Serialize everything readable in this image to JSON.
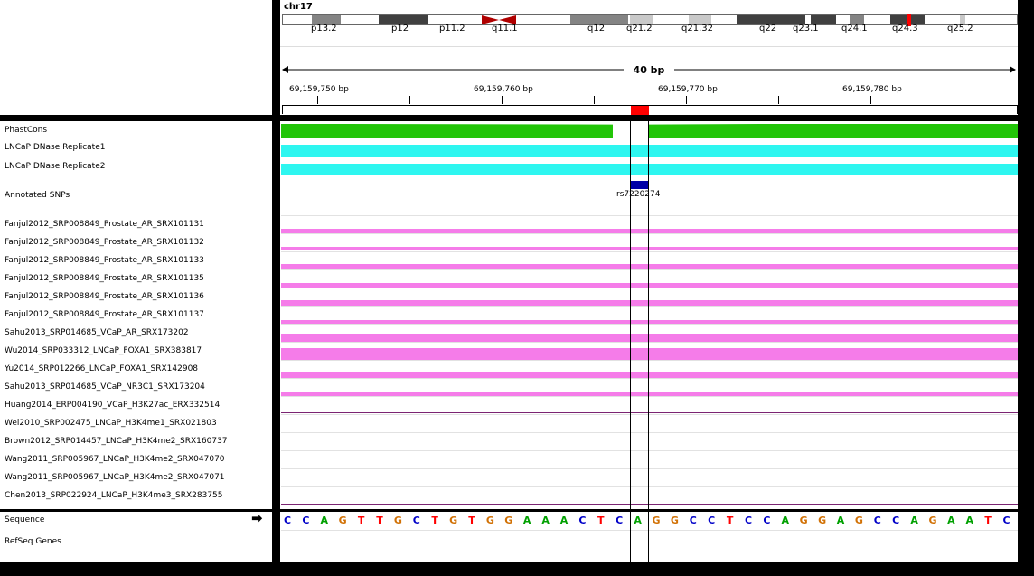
{
  "ideogram": {
    "chromosome": "chr17",
    "bands": [
      {
        "label": "p13.2",
        "color": "#848484"
      },
      {
        "label": "p12",
        "color": "#404040"
      },
      {
        "label": "p11.2",
        "color": "#ffffff"
      },
      {
        "label": "q11.1",
        "color": "#b00000"
      },
      {
        "label": "q12",
        "color": "#848484"
      },
      {
        "label": "q21.2",
        "color": "#c9c9c9"
      },
      {
        "label": "q21.32",
        "color": "#c9c9c9"
      },
      {
        "label": "q22",
        "color": "#404040"
      },
      {
        "label": "q23.1",
        "color": "#404040"
      },
      {
        "label": "q24.1",
        "color": "#848484"
      },
      {
        "label": "q24.3",
        "color": "#404040"
      },
      {
        "label": "q25.2",
        "color": "#c9c9c9"
      }
    ],
    "current_position_color": "#ff0000"
  },
  "ruler": {
    "span_label": "40 bp",
    "ticks": [
      "69,159,750 bp",
      "69,159,760 bp",
      "69,159,770 bp",
      "69,159,780 bp"
    ]
  },
  "tracks": {
    "phastcons": {
      "name": "PhastCons",
      "color": "#22c508"
    },
    "dnase1": {
      "name": "LNCaP DNase Replicate1",
      "color": "#2ef6f0"
    },
    "dnase2": {
      "name": "LNCaP DNase Replicate2",
      "color": "#2ef6f0"
    },
    "snps": {
      "name": "Annotated SNPs",
      "feature_label": "rs7220274",
      "color": "#0000a6"
    },
    "chip": [
      "Fanjul2012_SRP008849_Prostate_AR_SRX101131",
      "Fanjul2012_SRP008849_Prostate_AR_SRX101132",
      "Fanjul2012_SRP008849_Prostate_AR_SRX101133",
      "Fanjul2012_SRP008849_Prostate_AR_SRX101135",
      "Fanjul2012_SRP008849_Prostate_AR_SRX101136",
      "Fanjul2012_SRP008849_Prostate_AR_SRX101137",
      "Sahu2013_SRP014685_VCaP_AR_SRX173202",
      "Wu2014_SRP033312_LNCaP_FOXA1_SRX383817",
      "Yu2014_SRP012266_LNCaP_FOXA1_SRX142908",
      "Sahu2013_SRP014685_VCaP_NR3C1_SRX173204",
      "Huang2014_ERP004190_VCaP_H3K27ac_ERX332514",
      "Wei2010_SRP002475_LNCaP_H3K4me1_SRX021803",
      "Brown2012_SRP014457_LNCaP_H3K4me2_SRX160737",
      "Wang2011_SRP005967_LNCaP_H3K4me2_SRX047070",
      "Wang2011_SRP005967_LNCaP_H3K4me2_SRX047071",
      "Chen2013_SRP022924_LNCaP_H3K4me3_SRX283755"
    ],
    "chip_color": "#f57ce9",
    "flat_line_color": "#7b2472",
    "sequence": {
      "name": "Sequence",
      "strand_arrow": "➡",
      "bases": [
        "C",
        "C",
        "A",
        "G",
        "T",
        "T",
        "G",
        "C",
        "T",
        "G",
        "T",
        "G",
        "G",
        "A",
        "A",
        "A",
        "C",
        "T",
        "C",
        "A",
        "G",
        "G",
        "C",
        "C",
        "T",
        "C",
        "C",
        "A",
        "G",
        "G",
        "A",
        "G",
        "C",
        "C",
        "A",
        "G",
        "A",
        "A",
        "T",
        "C"
      ]
    },
    "refseq": {
      "name": "RefSeq Genes"
    }
  },
  "base_colors": {
    "A": "#00a000",
    "C": "#0000c8",
    "G": "#d17105",
    "T": "#ff0000"
  }
}
